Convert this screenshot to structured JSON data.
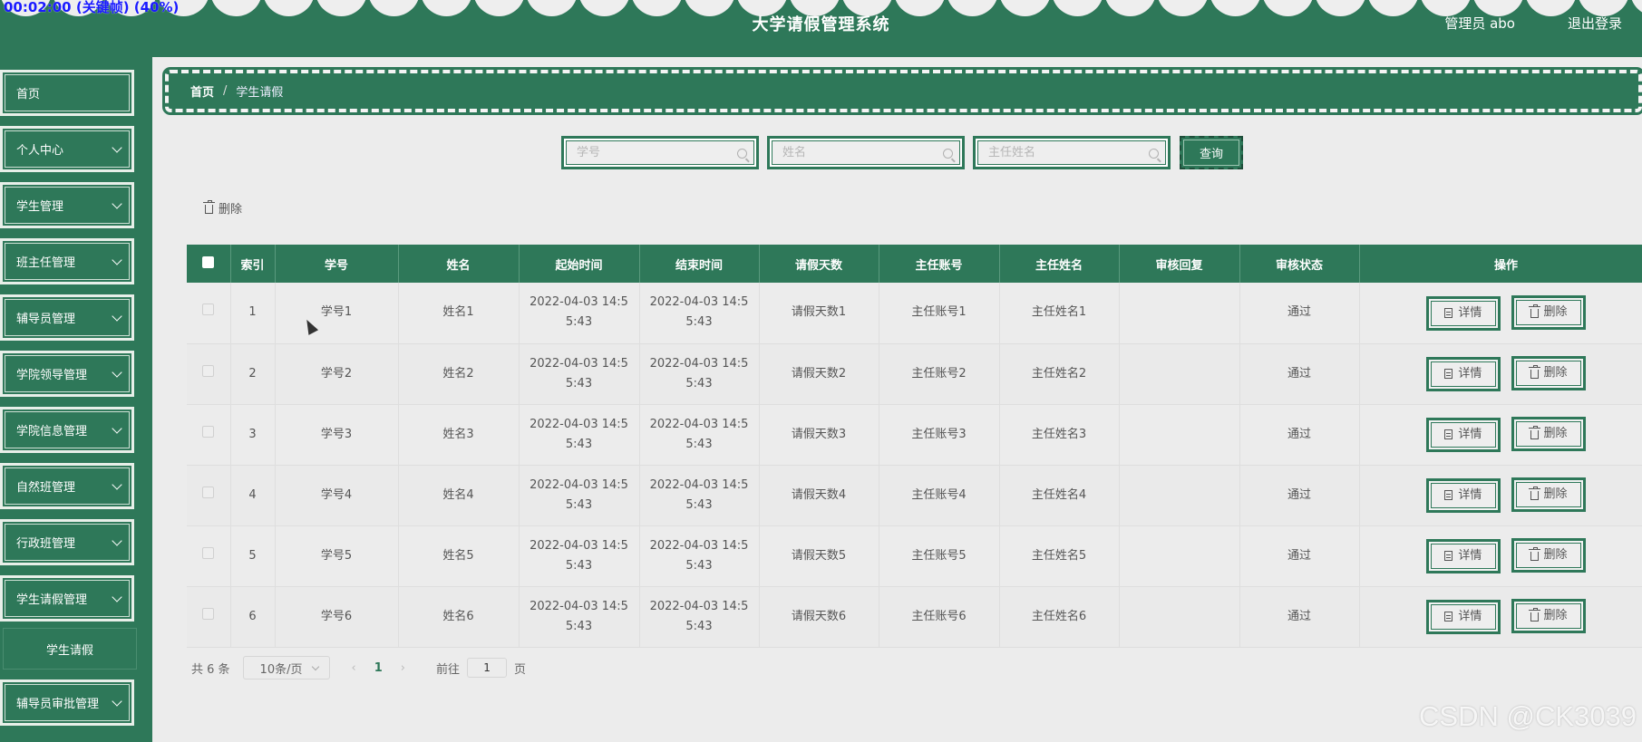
{
  "overlay": {
    "recording": "00:02:00 (关键帧) (40%)"
  },
  "header": {
    "title": "大学请假管理系统",
    "user": "管理员 abo",
    "logout": "退出登录"
  },
  "sidebar": {
    "items": [
      {
        "label": "首页",
        "has_children": false
      },
      {
        "label": "个人中心",
        "has_children": true
      },
      {
        "label": "学生管理",
        "has_children": true
      },
      {
        "label": "班主任管理",
        "has_children": true
      },
      {
        "label": "辅导员管理",
        "has_children": true
      },
      {
        "label": "学院领导管理",
        "has_children": true
      },
      {
        "label": "学院信息管理",
        "has_children": true
      },
      {
        "label": "自然班管理",
        "has_children": true
      },
      {
        "label": "行政班管理",
        "has_children": true
      },
      {
        "label": "学生请假管理",
        "has_children": true
      },
      {
        "label": "辅导员审批管理",
        "has_children": true
      }
    ],
    "submenu": {
      "label": "学生请假"
    }
  },
  "breadcrumb": {
    "home": "首页",
    "separator": "/",
    "current": "学生请假"
  },
  "search": {
    "student_no_placeholder": "学号",
    "name_placeholder": "姓名",
    "director_placeholder": "主任姓名",
    "query_label": "查询"
  },
  "toolbar": {
    "delete_label": "删除"
  },
  "table": {
    "columns": [
      "索引",
      "学号",
      "姓名",
      "起始时间",
      "结束时间",
      "请假天数",
      "主任账号",
      "主任姓名",
      "审核回复",
      "审核状态",
      "操作"
    ],
    "rows": [
      {
        "index": "1",
        "student_no": "学号1",
        "name": "姓名1",
        "start": "2022-04-03 14:5",
        "start2": "5:43",
        "end": "2022-04-03 14:5",
        "end2": "5:43",
        "days": "请假天数1",
        "director_account": "主任账号1",
        "director_name": "主任姓名1",
        "reply": "",
        "status": "通过"
      },
      {
        "index": "2",
        "student_no": "学号2",
        "name": "姓名2",
        "start": "2022-04-03 14:5",
        "start2": "5:43",
        "end": "2022-04-03 14:5",
        "end2": "5:43",
        "days": "请假天数2",
        "director_account": "主任账号2",
        "director_name": "主任姓名2",
        "reply": "",
        "status": "通过"
      },
      {
        "index": "3",
        "student_no": "学号3",
        "name": "姓名3",
        "start": "2022-04-03 14:5",
        "start2": "5:43",
        "end": "2022-04-03 14:5",
        "end2": "5:43",
        "days": "请假天数3",
        "director_account": "主任账号3",
        "director_name": "主任姓名3",
        "reply": "",
        "status": "通过"
      },
      {
        "index": "4",
        "student_no": "学号4",
        "name": "姓名4",
        "start": "2022-04-03 14:5",
        "start2": "5:43",
        "end": "2022-04-03 14:5",
        "end2": "5:43",
        "days": "请假天数4",
        "director_account": "主任账号4",
        "director_name": "主任姓名4",
        "reply": "",
        "status": "通过"
      },
      {
        "index": "5",
        "student_no": "学号5",
        "name": "姓名5",
        "start": "2022-04-03 14:5",
        "start2": "5:43",
        "end": "2022-04-03 14:5",
        "end2": "5:43",
        "days": "请假天数5",
        "director_account": "主任账号5",
        "director_name": "主任姓名5",
        "reply": "",
        "status": "通过"
      },
      {
        "index": "6",
        "student_no": "学号6",
        "name": "姓名6",
        "start": "2022-04-03 14:5",
        "start2": "5:43",
        "end": "2022-04-03 14:5",
        "end2": "5:43",
        "days": "请假天数6",
        "director_account": "主任账号6",
        "director_name": "主任姓名6",
        "reply": "",
        "status": "通过"
      }
    ],
    "actions": {
      "detail": "详情",
      "delete": "删除"
    }
  },
  "pagination": {
    "total": "共 6 条",
    "page_size": "10条/页",
    "current_page": "1",
    "goto_label": "前往",
    "goto_value": "1",
    "page_suffix": "页"
  },
  "watermark": "CSDN @CK3039",
  "colors": {
    "primary": "#2e7859",
    "background": "#ececec"
  }
}
